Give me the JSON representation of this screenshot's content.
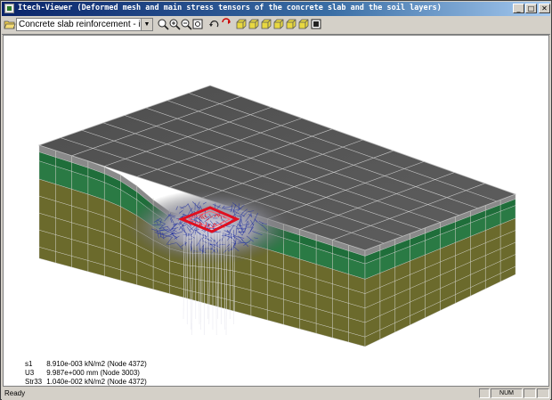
{
  "window": {
    "title": "Itech-Viewer (Deformed mesh and main stress tensors of the concrete slab and the soil layers)",
    "min_glyph": "_",
    "max_glyph": "□",
    "close_glyph": "✕"
  },
  "toolbar": {
    "model_select": "Concrete slab reinforcement - itech fo",
    "icons": [
      "open-icon",
      "zoom-icon",
      "zoom-in-icon",
      "zoom-out-icon",
      "zoom-fit-icon",
      "rotate-icon",
      "flip-icon",
      "view-xy-icon",
      "view-xz-icon",
      "view-yz-icon",
      "view-iso-icon",
      "view-top-icon",
      "view-front-icon",
      "print-icon"
    ]
  },
  "readout": [
    {
      "label": "s1",
      "value": "8.910e-003 kN/m2 (Node 4372)"
    },
    {
      "label": "U3",
      "value": "9.987e+000 mm (Node 3003)"
    },
    {
      "label": "Str33",
      "value": "1.040e-002 kN/m2 (Node 4372)"
    }
  ],
  "status": {
    "text": "Ready",
    "num": "NUM"
  },
  "colors": {
    "slab_top": "#5a5a5a",
    "soil_green": "#1f6e3a",
    "soil_olive": "#6b6a2c",
    "stress_blue": "#2030a0",
    "stress_red": "#e01020"
  }
}
